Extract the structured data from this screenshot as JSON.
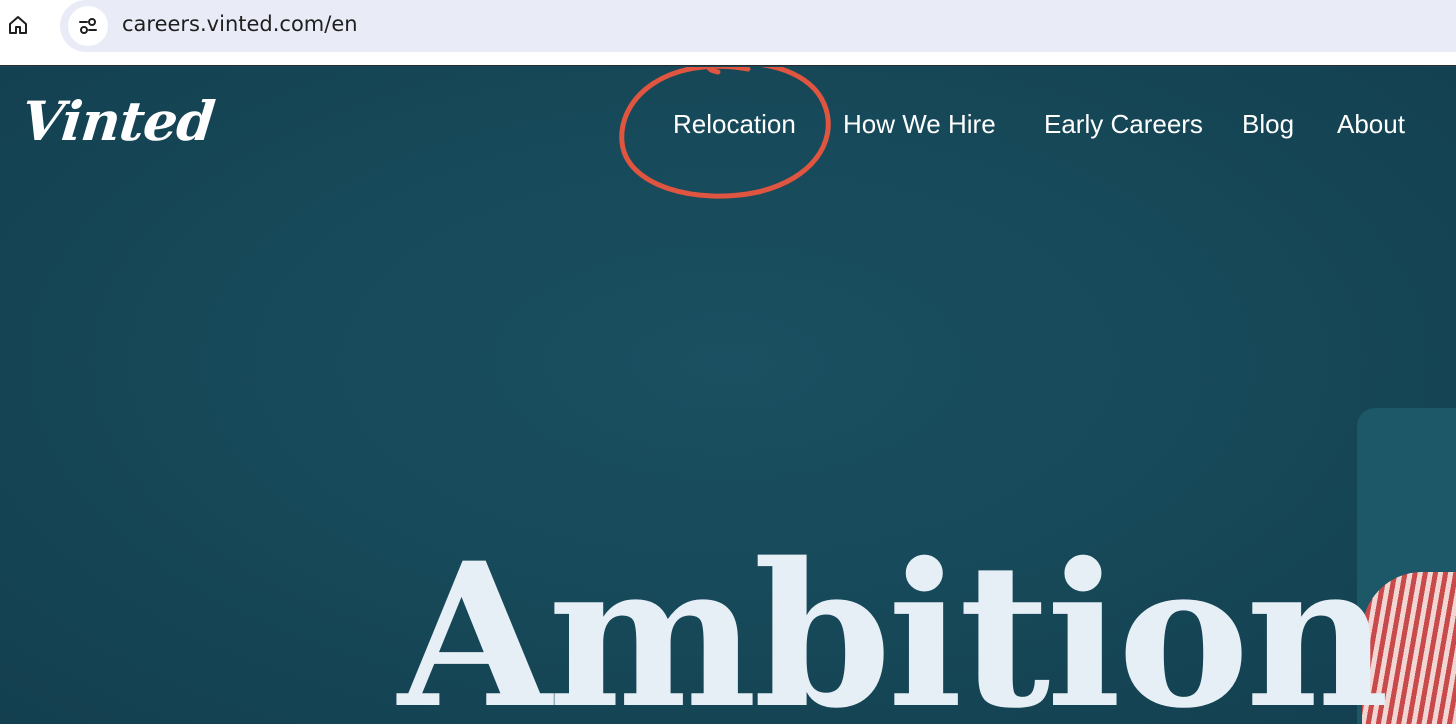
{
  "browser": {
    "url": "careers.vinted.com/en"
  },
  "site": {
    "logo": "Vinted",
    "nav": [
      {
        "label": "Relocation"
      },
      {
        "label": "How We Hire"
      },
      {
        "label": "Early Careers"
      },
      {
        "label": "Blog"
      },
      {
        "label": "About"
      }
    ]
  },
  "hero": {
    "title": "Ambition"
  },
  "colors": {
    "page_background": "#164858",
    "annotation": "#e0553f",
    "hero_text": "#e6eef6",
    "browser_bar": "#e9ecf6"
  },
  "icons": {
    "home": "home-icon",
    "site_info": "tune-icon"
  }
}
